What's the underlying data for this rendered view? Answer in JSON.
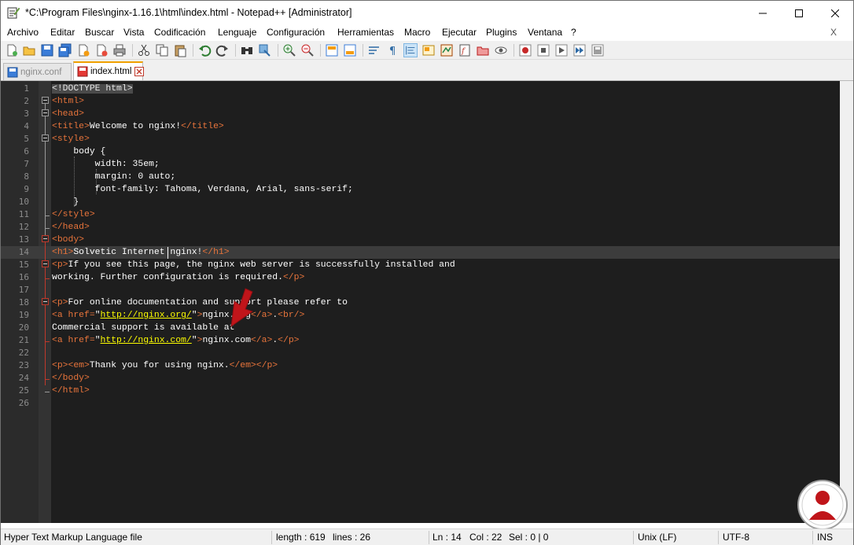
{
  "window": {
    "title": "*C:\\Program Files\\nginx-1.16.1\\html\\index.html - Notepad++ [Administrator]"
  },
  "menu": {
    "items": [
      "Archivo",
      "Editar",
      "Buscar",
      "Vista",
      "Codificación",
      "Lenguaje",
      "Configuración",
      "Herramientas",
      "Macro",
      "Ejecutar",
      "Plugins",
      "Ventana",
      "?"
    ],
    "close_label": "X"
  },
  "tabs": [
    {
      "label": "nginx.conf",
      "active": false
    },
    {
      "label": "index.html",
      "active": true
    }
  ],
  "editor": {
    "current_line": 14,
    "lines": [
      {
        "n": "1",
        "fold": "none"
      },
      {
        "n": "2",
        "fold": "open"
      },
      {
        "n": "3",
        "fold": "open"
      },
      {
        "n": "4",
        "fold": "line"
      },
      {
        "n": "5",
        "fold": "open"
      },
      {
        "n": "6",
        "fold": "line"
      },
      {
        "n": "7",
        "fold": "line"
      },
      {
        "n": "8",
        "fold": "line"
      },
      {
        "n": "9",
        "fold": "line"
      },
      {
        "n": "10",
        "fold": "line"
      },
      {
        "n": "11",
        "fold": "end"
      },
      {
        "n": "12",
        "fold": "end"
      },
      {
        "n": "13",
        "fold": "open"
      },
      {
        "n": "14",
        "fold": "line"
      },
      {
        "n": "15",
        "fold": "open"
      },
      {
        "n": "16",
        "fold": "end"
      },
      {
        "n": "17",
        "fold": "line"
      },
      {
        "n": "18",
        "fold": "open"
      },
      {
        "n": "19",
        "fold": "line"
      },
      {
        "n": "20",
        "fold": "line"
      },
      {
        "n": "21",
        "fold": "end"
      },
      {
        "n": "22",
        "fold": "line"
      },
      {
        "n": "23",
        "fold": "line"
      },
      {
        "n": "24",
        "fold": "end"
      },
      {
        "n": "25",
        "fold": "end"
      },
      {
        "n": "26",
        "fold": "none"
      }
    ],
    "code": {
      "l1_doctype": "<!DOCTYPE html>",
      "l2": "<html>",
      "l3": "<head>",
      "l4_open": "<title>",
      "l4_text": "Welcome to nginx!",
      "l4_close": "</title>",
      "l5": "<style>",
      "l6": "    body {",
      "l7": "        width: 35em;",
      "l8": "        margin: 0 auto;",
      "l9": "        font-family: Tahoma, Verdana, Arial, sans-serif;",
      "l10": "    }",
      "l11": "</style>",
      "l12": "</head>",
      "l13": "<body>",
      "l14_open": "<h1>",
      "l14_text": "Solvetic Internet nginx!",
      "l14_close": "</h1>",
      "l15_open": "<p>",
      "l15_text": "If you see this page, the nginx web server is successfully installed and",
      "l16_text": "working. Further configuration is required.",
      "l16_close": "</p>",
      "l18_open": "<p>",
      "l18_text": "For online documentation and support please refer to",
      "l19_a": "<a href=",
      "l19_q1": "\"",
      "l19_url": "http://nginx.org/",
      "l19_q2": "\"",
      "l19_gt": ">",
      "l19_text": "nginx.org",
      "l19_close": "</a>",
      "l19_dot": ".",
      "l19_br": "<br/>",
      "l20_text": "Commercial support is available at",
      "l21_a": "<a href=",
      "l21_q1": "\"",
      "l21_url": "http://nginx.com/",
      "l21_q2": "\"",
      "l21_gt": ">",
      "l21_text": "nginx.com",
      "l21_close": "</a>",
      "l21_dot": ".",
      "l21_p": "</p>",
      "l23_open": "<p><em>",
      "l23_text": "Thank you for using nginx.",
      "l23_close": "</em></p>",
      "l24": "</body>",
      "l25": "</html>"
    }
  },
  "statusbar": {
    "filetype": "Hyper Text Markup Language file",
    "length": "length : 619",
    "lines": "lines : 26",
    "ln": "Ln : 14",
    "col": "Col : 22",
    "sel": "Sel : 0 | 0",
    "eol": "Unix (LF)",
    "encoding": "UTF-8",
    "mode": "INS"
  },
  "colors": {
    "tag": "#e8743b",
    "text": "#ffffff",
    "url": "#ffff00",
    "background": "#1e1e1e",
    "arrow": "#c0151a"
  },
  "icons": [
    "notepadpp-icon",
    "minimize-icon",
    "maximize-icon",
    "close-icon",
    "new-file-icon",
    "open-file-icon",
    "save-icon",
    "save-all-icon",
    "close-file-icon",
    "close-all-icon",
    "print-icon",
    "cut-icon",
    "copy-icon",
    "paste-icon",
    "undo-icon",
    "redo-icon",
    "find-icon",
    "replace-icon",
    "zoom-in-icon",
    "zoom-out-icon",
    "sync-vertical-icon",
    "sync-horizontal-icon",
    "word-wrap-icon",
    "show-all-chars-icon",
    "indent-guide-icon",
    "user-lang-icon",
    "doc-map-icon",
    "function-list-icon",
    "folder-workspace-icon",
    "monitoring-icon",
    "record-macro-icon",
    "stop-macro-icon",
    "play-macro-icon",
    "run-macro-multiple-icon",
    "save-macro-icon",
    "red-arrow-icon",
    "solvetic-logo-icon"
  ]
}
